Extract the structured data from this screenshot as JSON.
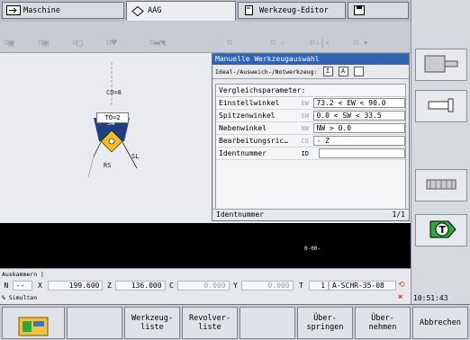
{
  "tabs": [
    {
      "label": "Maschine",
      "icon": "arrow-right-icon"
    },
    {
      "label": "AAG",
      "icon": "diamond-arrows-icon"
    },
    {
      "label": "Werkzeug-Editor",
      "icon": "tool-file-icon"
    },
    {
      "label": "",
      "icon": "save-icon"
    }
  ],
  "graphic": {
    "to_label": "TO=2",
    "co_label": "CO=8",
    "sw_label": "SW",
    "sl_label": "SL",
    "rs_label": "RS"
  },
  "dialog": {
    "title": "Manuelle Werkzeugauswahl",
    "subtitle": "Ideal-/Ausweich-/Notwerkzeug:",
    "checks": [
      "I",
      "A",
      ""
    ],
    "section_title": "Vergleichsparameter:",
    "params": [
      {
        "name": "Einstellwinkel",
        "code": "EW",
        "value": "73.2 < EW < 90.0"
      },
      {
        "name": "Spitzenwinkel",
        "code": "SW",
        "value": "0.0 < SW < 33.5"
      },
      {
        "name": "Nebenwinkel",
        "code": "NW",
        "value": "NW > 0.0"
      },
      {
        "name": "Bearbeitungsric…",
        "code": "CO",
        "value": "- Z"
      },
      {
        "name": "Identnummer",
        "code": "ID",
        "value": ""
      }
    ],
    "footer_label": "Identnummer",
    "footer_page": "1/1"
  },
  "blackarea": {
    "text": "0-00-"
  },
  "status": {
    "line1": "Auskammern |",
    "axes": [
      {
        "name": "N",
        "value": "--"
      },
      {
        "name": "X",
        "value": "199.600"
      },
      {
        "name": "Z",
        "value": "136.000"
      },
      {
        "name": "C",
        "value": "0.000"
      },
      {
        "name": "Y",
        "value": "0.000"
      },
      {
        "name": "T",
        "value": "1"
      }
    ],
    "tool_name": "A-SCHR-35-08",
    "line2": "% Simultan",
    "time": "10:51:43"
  },
  "softkeys": [
    {
      "label": "",
      "icon": "machine-icon"
    },
    {
      "label": ""
    },
    {
      "label": "Werkzeug-\nliste"
    },
    {
      "label": "Revolver-\nliste"
    },
    {
      "label": ""
    },
    {
      "label": "Über-\nspringen"
    },
    {
      "label": "Über-\nnehmen"
    },
    {
      "label": "Abbrechen"
    }
  ],
  "colors": {
    "accent": "#2f63b4",
    "warning": "#e04b1b"
  }
}
